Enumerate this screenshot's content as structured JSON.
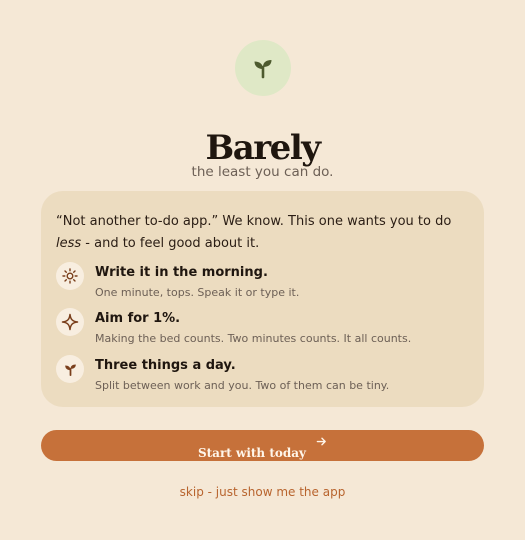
{
  "app": {
    "title": "Barely",
    "tagline": "the least you can do."
  },
  "intro": {
    "before_em": "“Not another to-do app.” We know. This one wants you to do ",
    "em": "less",
    "after_em": " - and to feel good about it."
  },
  "features": [
    {
      "icon": "sun-icon",
      "title": "Write it in the morning.",
      "desc": "One minute, tops. Speak it or type it."
    },
    {
      "icon": "sparkle-icon",
      "title": "Aim for 1%.",
      "desc": "Making the bed counts. Two minutes counts. It all counts."
    },
    {
      "icon": "sprout-icon",
      "title": "Three things a day.",
      "desc": "Split between work and you. Two of them can be tiny."
    }
  ],
  "actions": {
    "start_label": "Start with today",
    "skip_label": "skip - just show me the app"
  },
  "colors": {
    "background": "#f5e8d6",
    "card": "#ecdcc0",
    "accent": "#c6713a",
    "logo_bg": "#dfe8c6",
    "logo_icon": "#4d5a2e"
  }
}
